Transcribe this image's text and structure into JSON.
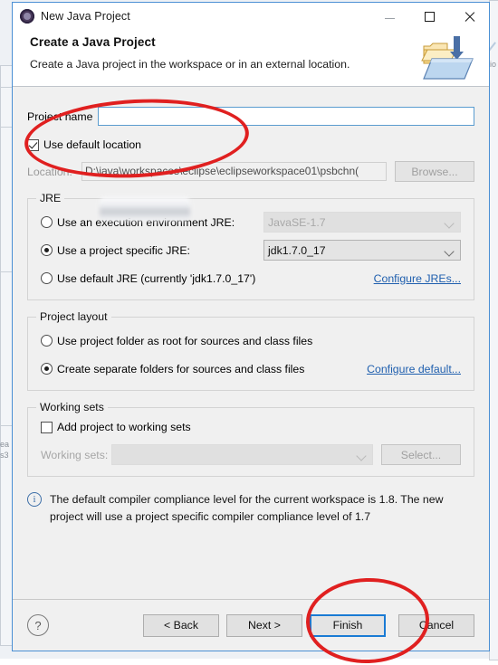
{
  "window": {
    "title": "New Java Project",
    "icon": "java-project-icon",
    "controls": {
      "minimize": "minimize-icon",
      "maximize": "maximize-icon",
      "close": "close-icon"
    }
  },
  "banner": {
    "title": "Create a Java Project",
    "subtitle": "Create a Java project in the workspace or in an external location.",
    "icon": "new-java-project-folder-icon"
  },
  "form": {
    "project_name_label": "Project name",
    "project_name_value": "",
    "project_name_placeholder": "",
    "use_default_location_label": "Use default location",
    "use_default_location_checked": true,
    "location_label": "Location:",
    "location_value": "D:\\java\\workspaces\\eclipse\\eclipseworkspace01\\psbchn(",
    "browse_label": "Browse..."
  },
  "jre": {
    "legend": "JRE",
    "options": [
      {
        "label": "Use an execution environment JRE:",
        "selected": false
      },
      {
        "label": "Use a project specific JRE:",
        "selected": true
      },
      {
        "label": "Use default JRE (currently 'jdk1.7.0_17')",
        "selected": false
      }
    ],
    "execution_env_value": "JavaSE-1.7",
    "project_jre_value": "jdk1.7.0_17",
    "configure_link": "Configure JREs..."
  },
  "project_layout": {
    "legend": "Project layout",
    "options": [
      {
        "label": "Use project folder as root for sources and class files",
        "selected": false
      },
      {
        "label": "Create separate folders for sources and class files",
        "selected": true
      }
    ],
    "configure_link": "Configure default..."
  },
  "working_sets": {
    "legend": "Working sets",
    "add_label": "Add project to working sets",
    "add_checked": false,
    "sets_label": "Working sets:",
    "sets_value": "",
    "select_label": "Select..."
  },
  "info": {
    "icon": "info-icon",
    "line1": "The default compiler compliance level for the current workspace is 1.8. The new",
    "line2": "project will use a project specific compiler compliance level of 1.7"
  },
  "buttons": {
    "help": "?",
    "back": "< Back",
    "next": "Next >",
    "finish": "Finish",
    "cancel": "Cancel"
  },
  "annotations": {
    "ellipse_project_name": "red-ellipse-highlight",
    "ellipse_finish": "red-ellipse-highlight"
  },
  "background": {
    "edge_label_right": "io"
  },
  "colors": {
    "accent": "#1a7bd4",
    "link": "#1f5fae",
    "annotation": "#e02020",
    "dialog_bg": "#f0f0f0"
  }
}
